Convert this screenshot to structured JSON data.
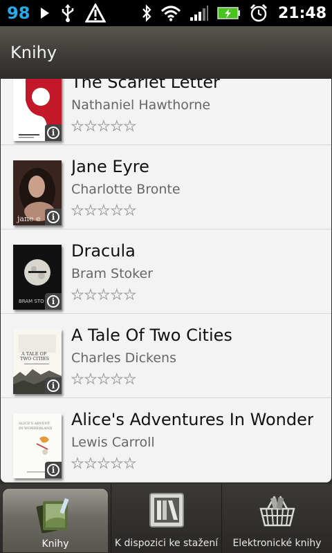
{
  "status_bar": {
    "notification_count": "98",
    "time": "21:48"
  },
  "header": {
    "title": "Knihy"
  },
  "books": [
    {
      "title": "The Scarlet Letter",
      "author": "Nathaniel Hawthorne",
      "rating": 0,
      "cover": "scarlet-letter-cover"
    },
    {
      "title": "Jane Eyre",
      "author": "Charlotte Bronte",
      "rating": 0,
      "cover": "jane-eyre-cover"
    },
    {
      "title": "Dracula",
      "author": "Bram Stoker",
      "rating": 0,
      "cover": "dracula-cover"
    },
    {
      "title": "A Tale Of Two Cities",
      "author": "Charles Dickens",
      "rating": 0,
      "cover": "tale-of-two-cities-cover"
    },
    {
      "title": "Alice's Adventures In Wonderland",
      "author": "Lewis Carroll",
      "rating": 0,
      "cover": "alice-cover"
    }
  ],
  "tabs": [
    {
      "label": "Knihy",
      "active": true,
      "icon": "books-icon"
    },
    {
      "label": "K dispozici ke stažení",
      "active": false,
      "icon": "bookshelf-icon"
    },
    {
      "label": "Elektronické knihy",
      "active": false,
      "icon": "basket-icon"
    }
  ],
  "colors": {
    "accent": "#2aa9e8",
    "battery": "#47c21f",
    "list_background": "#f3f3f3"
  }
}
